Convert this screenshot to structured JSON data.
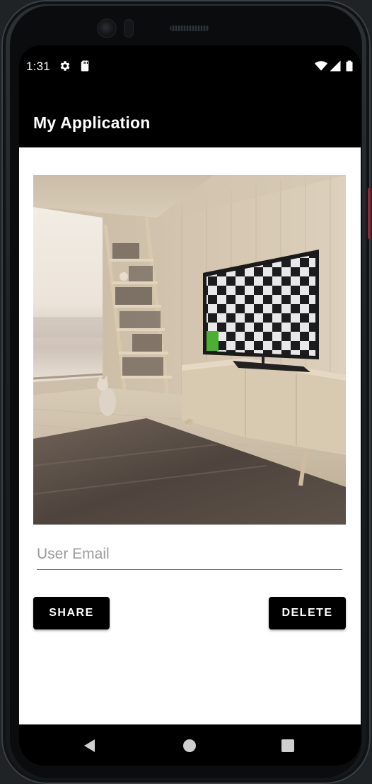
{
  "status_bar": {
    "time": "1:31",
    "icons": [
      "gear-icon",
      "sd-card-icon",
      "wifi-icon",
      "signal-icon",
      "battery-icon"
    ]
  },
  "app_bar": {
    "title": "My Application"
  },
  "image": {
    "subject": "room-with-tv-checkerboard"
  },
  "form": {
    "email_placeholder": "User Email",
    "email_value": ""
  },
  "buttons": {
    "share_label": "SHARE",
    "delete_label": "DELETE"
  },
  "nav_bar": {
    "icons": [
      "back-icon",
      "home-icon",
      "recents-icon"
    ]
  },
  "colors": {
    "app_bar": "#000000",
    "accent_green": "#4caf32",
    "button_bg": "#000000",
    "button_text": "#ffffff"
  }
}
